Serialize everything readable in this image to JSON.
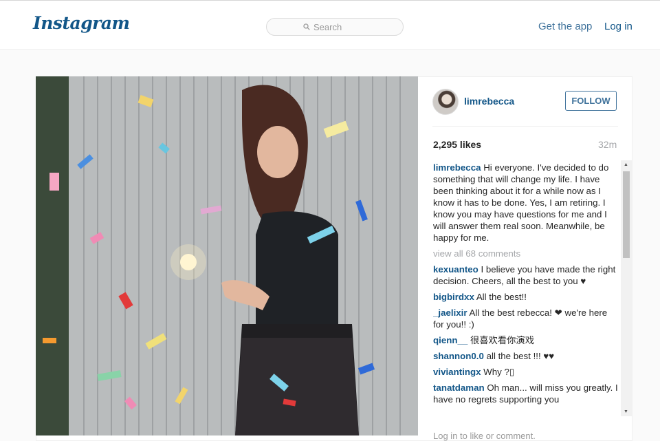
{
  "header": {
    "logo": "Instagram",
    "search_placeholder": "Search",
    "get_app": "Get the app",
    "login": "Log in"
  },
  "post": {
    "username": "limrebecca",
    "follow_label": "FOLLOW",
    "likes": "2,295 likes",
    "time": "32m",
    "caption_user": "limrebecca",
    "caption_text": "Hi everyone. I've decided to do something that will change my life. I have been thinking about it for a while now as I know it has to be done. Yes, I am retiring. I know you may have questions for me and I will answer them real soon. Meanwhile, be happy for me.",
    "view_all": "view all 68 comments",
    "comments": [
      {
        "user": "kexuanteo",
        "text": "I believe you have made the right decision. Cheers, all the best to you ♥"
      },
      {
        "user": "bigbirdxx",
        "text": "All the best!!"
      },
      {
        "user": "_jaelixir",
        "text": "All the best rebecca! ❤ we're here for you!! :)"
      },
      {
        "user": "qienn__",
        "text": "很喜欢看你演戏"
      },
      {
        "user": "shannon0.0",
        "text": "all the best !!! ♥♥"
      },
      {
        "user": "viviantingx",
        "text": "Why ?▯"
      },
      {
        "user": "tanatdaman",
        "text": "Oh man... will miss you greatly. I have no regrets supporting you"
      }
    ],
    "add_comment": "Log in to like or comment."
  }
}
